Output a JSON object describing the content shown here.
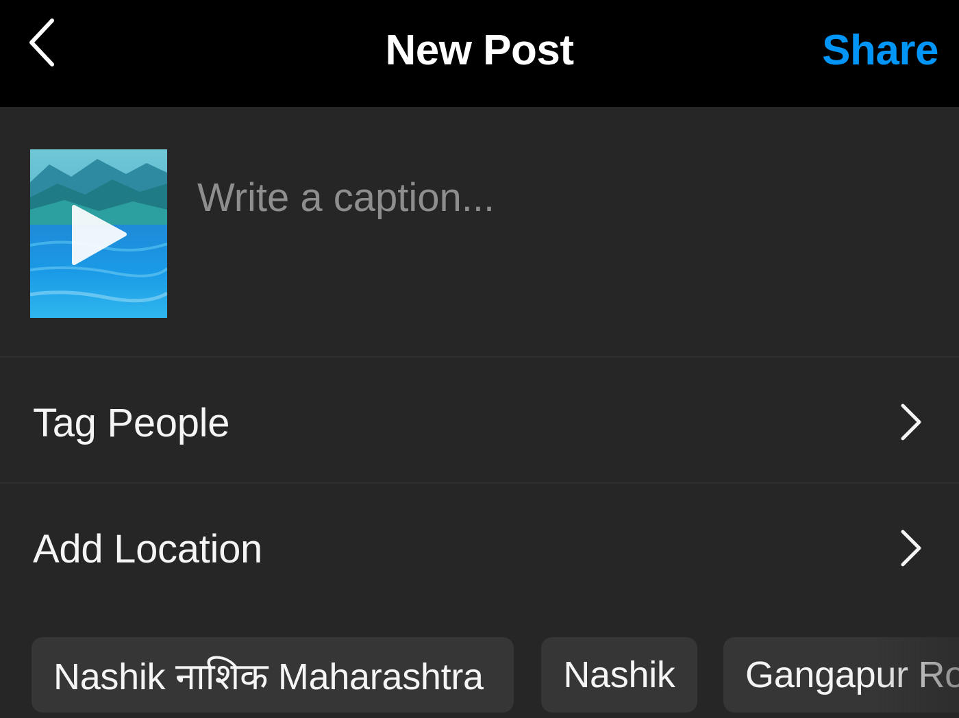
{
  "header": {
    "back_icon": "chevron-left-icon",
    "title": "New Post",
    "share_label": "Share",
    "share_color": "#0095f6"
  },
  "caption": {
    "placeholder": "Write a caption...",
    "value": "",
    "thumbnail": {
      "kind": "video",
      "icon": "play-icon"
    }
  },
  "rows": [
    {
      "label": "Tag People",
      "icon": "chevron-right-icon"
    },
    {
      "label": "Add Location",
      "icon": "chevron-right-icon"
    }
  ],
  "location_suggestions": [
    "Nashik नाशिक Maharashtra",
    "Nashik",
    "Gangapur Ro"
  ],
  "colors": {
    "header_bg": "#000000",
    "body_bg": "#262626",
    "chip_bg": "#363636",
    "placeholder": "#8e8e8e"
  }
}
